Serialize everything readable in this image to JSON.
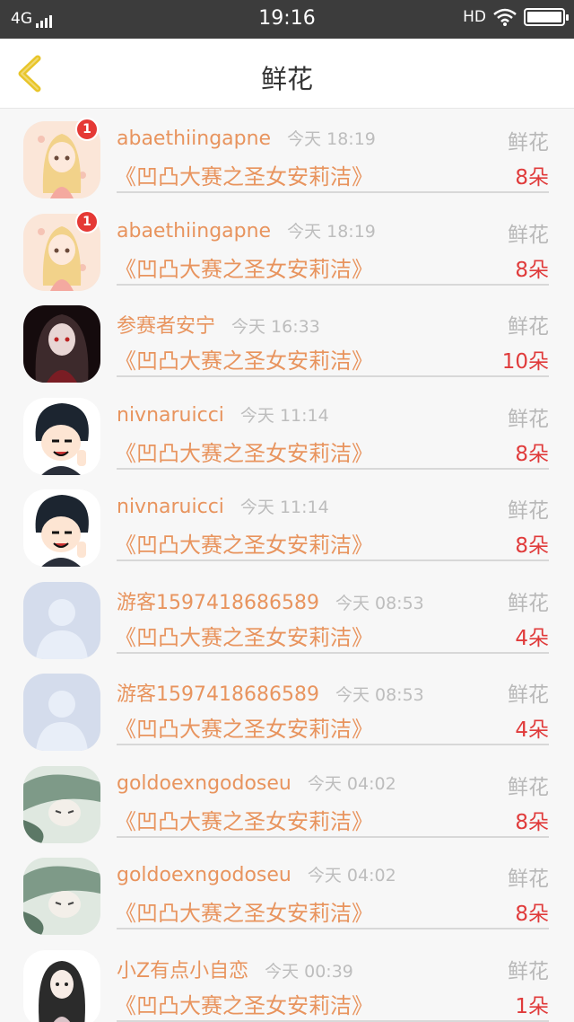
{
  "status_bar": {
    "network": "4G",
    "time": "19:16",
    "hd": "HD"
  },
  "nav": {
    "title": "鲜花"
  },
  "colors": {
    "accent": "#e8945e",
    "count": "#e03b3b",
    "back_arrow": "#e8c52a"
  },
  "rows": [
    {
      "name": "abaethiingapne",
      "time": "今天 18:19",
      "gift_type": "鲜花",
      "work": "《凹凸大赛之圣女安莉洁》",
      "count": "8朵",
      "badge": "1",
      "avatar": "anime-girl-blonde"
    },
    {
      "name": "abaethiingapne",
      "time": "今天 18:19",
      "gift_type": "鲜花",
      "work": "《凹凸大赛之圣女安莉洁》",
      "count": "8朵",
      "badge": "1",
      "avatar": "anime-girl-blonde"
    },
    {
      "name": "参赛者安宁",
      "time": "今天 16:33",
      "gift_type": "鲜花",
      "work": "《凹凸大赛之圣女安莉洁》",
      "count": "10朵",
      "badge": "",
      "avatar": "dark-anime-girl"
    },
    {
      "name": "nivnaruicci",
      "time": "今天 11:14",
      "gift_type": "鲜花",
      "work": "《凹凸大赛之圣女安莉洁》",
      "count": "8朵",
      "badge": "",
      "avatar": "chibi-boy"
    },
    {
      "name": "nivnaruicci",
      "time": "今天 11:14",
      "gift_type": "鲜花",
      "work": "《凹凸大赛之圣女安莉洁》",
      "count": "8朵",
      "badge": "",
      "avatar": "chibi-boy"
    },
    {
      "name": "游客1597418686589",
      "time": "今天 08:53",
      "gift_type": "鲜花",
      "work": "《凹凸大赛之圣女安莉洁》",
      "count": "4朵",
      "badge": "",
      "avatar": "default-silhouette"
    },
    {
      "name": "游客1597418686589",
      "time": "今天 08:53",
      "gift_type": "鲜花",
      "work": "《凹凸大赛之圣女安莉洁》",
      "count": "4朵",
      "badge": "",
      "avatar": "default-silhouette"
    },
    {
      "name": "goldoexngodoseu",
      "time": "今天 04:02",
      "gift_type": "鲜花",
      "work": "《凹凸大赛之圣女安莉洁》",
      "count": "8朵",
      "badge": "",
      "avatar": "anime-sketch"
    },
    {
      "name": "goldoexngodoseu",
      "time": "今天 04:02",
      "gift_type": "鲜花",
      "work": "《凹凸大赛之圣女安莉洁》",
      "count": "8朵",
      "badge": "",
      "avatar": "anime-sketch"
    },
    {
      "name": "小Z有点小自恋",
      "time": "今天 00:39",
      "gift_type": "鲜花",
      "work": "《凹凸大赛之圣女安莉洁》",
      "count": "1朵",
      "badge": "",
      "avatar": "long-hair-girl"
    }
  ]
}
